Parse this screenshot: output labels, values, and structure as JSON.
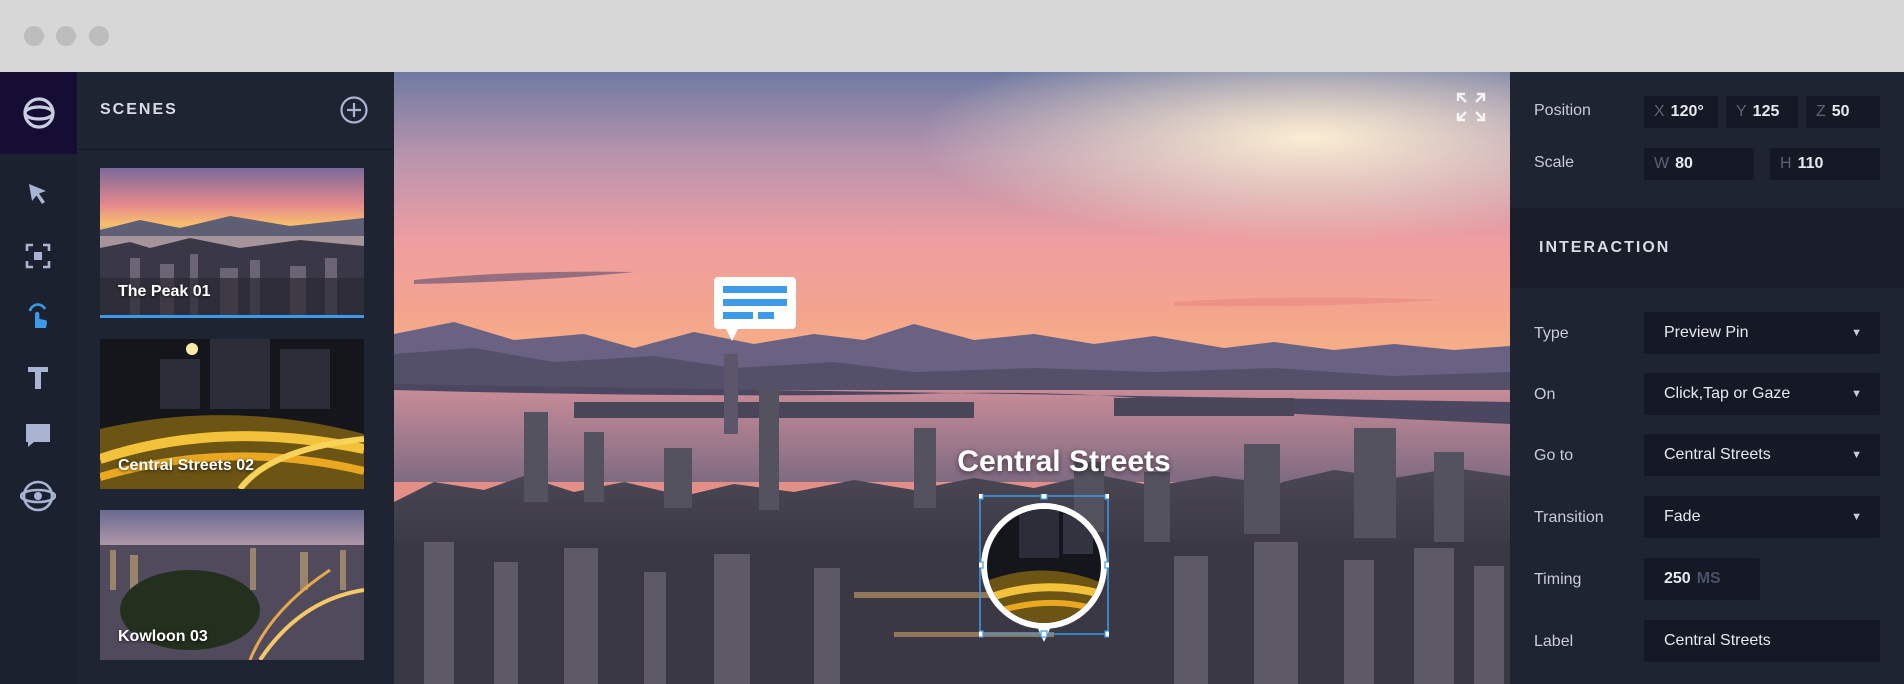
{
  "scenes_panel": {
    "title": "SCENES",
    "items": [
      {
        "label": "The Peak 01",
        "active": true
      },
      {
        "label": "Central Streets 02",
        "active": false
      },
      {
        "label": "Kowloon 03",
        "active": false
      }
    ]
  },
  "tool_rail": {
    "tools": [
      "logo-icon",
      "pointer-icon",
      "transform-icon",
      "hotspot-tap-icon",
      "text-icon",
      "comment-icon",
      "orbit-icon"
    ],
    "active_tool": "hotspot-tap-icon"
  },
  "viewport": {
    "hotspot_label": "Central Streets"
  },
  "properties": {
    "position": {
      "label": "Position",
      "x_key": "X",
      "x": "120°",
      "y_key": "Y",
      "y": "125",
      "z_key": "Z",
      "z": "50"
    },
    "scale": {
      "label": "Scale",
      "w_key": "W",
      "w": "80",
      "h_key": "H",
      "h": "110"
    },
    "interaction": {
      "title": "INTERACTION",
      "type": {
        "label": "Type",
        "value": "Preview Pin"
      },
      "on": {
        "label": "On",
        "value": "Click,Tap or Gaze"
      },
      "go_to": {
        "label": "Go to",
        "value": "Central Streets"
      },
      "transition": {
        "label": "Transition",
        "value": "Fade"
      },
      "timing": {
        "label": "Timing",
        "value": "250",
        "unit": "MS"
      },
      "label": {
        "label": "Label",
        "value": "Central Streets"
      }
    }
  },
  "colors": {
    "accent": "#3d9ae8",
    "panel": "#1f2433",
    "field": "#151926",
    "logo_bg": "#150d34"
  }
}
